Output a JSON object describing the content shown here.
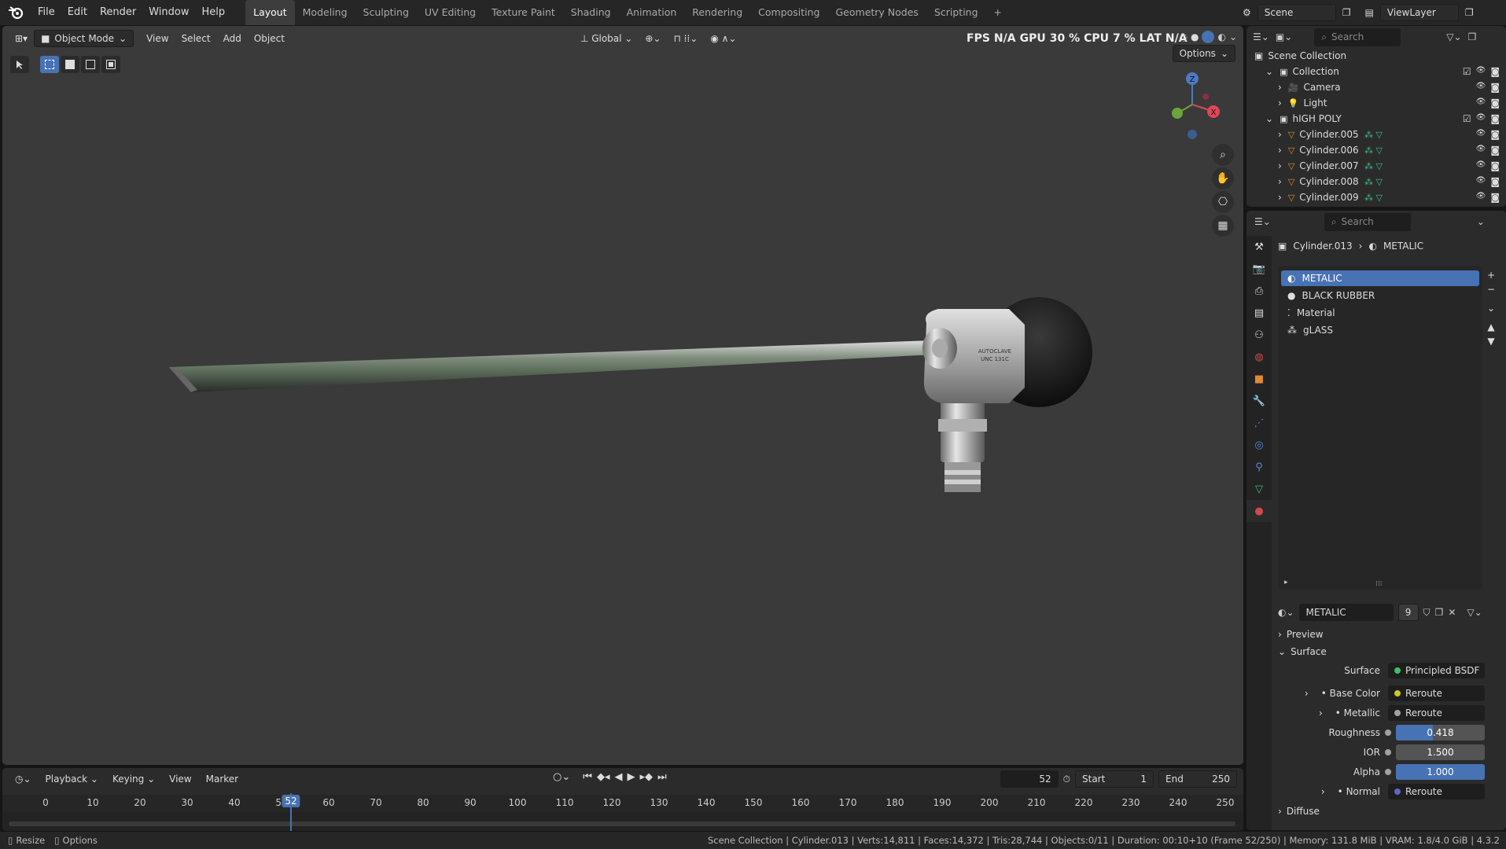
{
  "topbar": {
    "menus": [
      "File",
      "Edit",
      "Render",
      "Window",
      "Help"
    ],
    "workspaces": [
      "Layout",
      "Modeling",
      "Sculpting",
      "UV Editing",
      "Texture Paint",
      "Shading",
      "Animation",
      "Rendering",
      "Compositing",
      "Geometry Nodes",
      "Scripting"
    ],
    "active_workspace": "Layout",
    "scene": "Scene",
    "view_layer": "ViewLayer"
  },
  "viewport": {
    "mode": "Object Mode",
    "menus": [
      "View",
      "Select",
      "Add",
      "Object"
    ],
    "orientation": "Global",
    "overlay_stats": {
      "fps_label": "FPS",
      "fps": "N/A",
      "gpu_label": "GPU",
      "gpu": "30 %",
      "cpu_label": "CPU",
      "cpu": "7 %",
      "lat_label": "LAT",
      "lat": "N/A"
    },
    "options_label": "Options",
    "gizmo": {
      "z": "Z",
      "x": "X"
    },
    "background_color": "#3a3a3a"
  },
  "timeline": {
    "menus": [
      "Playback",
      "Keying",
      "View",
      "Marker"
    ],
    "current_frame": "52",
    "start_label": "Start",
    "start": "1",
    "end_label": "End",
    "end": "250",
    "ticks": [
      "0",
      "10",
      "20",
      "30",
      "40",
      "50",
      "60",
      "70",
      "80",
      "90",
      "100",
      "110",
      "120",
      "130",
      "140",
      "150",
      "160",
      "170",
      "180",
      "190",
      "200",
      "210",
      "220",
      "230",
      "240",
      "250"
    ]
  },
  "outliner": {
    "search_placeholder": "Search",
    "scene_collection": "Scene Collection",
    "rows": [
      {
        "label": "Collection",
        "type": "collection"
      },
      {
        "label": "Camera",
        "type": "camera"
      },
      {
        "label": "Light",
        "type": "light"
      },
      {
        "label": "hIGH POLY",
        "type": "collection"
      },
      {
        "label": "Cylinder.005",
        "type": "mesh"
      },
      {
        "label": "Cylinder.006",
        "type": "mesh"
      },
      {
        "label": "Cylinder.007",
        "type": "mesh"
      },
      {
        "label": "Cylinder.008",
        "type": "mesh"
      },
      {
        "label": "Cylinder.009",
        "type": "mesh"
      }
    ]
  },
  "properties": {
    "search_placeholder": "Search",
    "breadcrumb_object": "Cylinder.013",
    "breadcrumb_material": "METALIC",
    "slots": [
      "METALIC",
      "BLACK RUBBER",
      "Material",
      "gLASS"
    ],
    "active_slot": "METALIC",
    "material_name": "METALIC",
    "user_count": "9",
    "preview_label": "Preview",
    "surface_panel": "Surface",
    "surface_label": "Surface",
    "surface_value": "Principled BSDF",
    "fields": {
      "base_color_label": "Base Color",
      "base_color_value": "Reroute",
      "metallic_label": "Metallic",
      "metallic_value": "Reroute",
      "roughness_label": "Roughness",
      "roughness_value": "0.418",
      "ior_label": "IOR",
      "ior_value": "1.500",
      "alpha_label": "Alpha",
      "alpha_value": "1.000",
      "normal_label": "Normal",
      "normal_value": "Reroute",
      "diffuse_label": "Diffuse"
    },
    "roughness_fraction": 0.418,
    "alpha_fraction": 1.0
  },
  "statusbar": {
    "resize": "Resize",
    "options": "Options",
    "info": "Scene Collection | Cylinder.013 | Verts:14,811 | Faces:14,372 | Tris:28,744 | Objects:0/11 | Duration: 00:10+10 (Frame 52/250) | Memory: 131.8 MiB | VRAM: 1.8/4.0 GiB | 4.3.2"
  },
  "object_label": {
    "line1": "AUTOCLAVE",
    "line2": "UNC 131C"
  },
  "colors": {
    "accent": "#4772b3",
    "active_tab": "#3d3d3d",
    "metal": "#b9b9b9",
    "rubber": "#111111"
  }
}
